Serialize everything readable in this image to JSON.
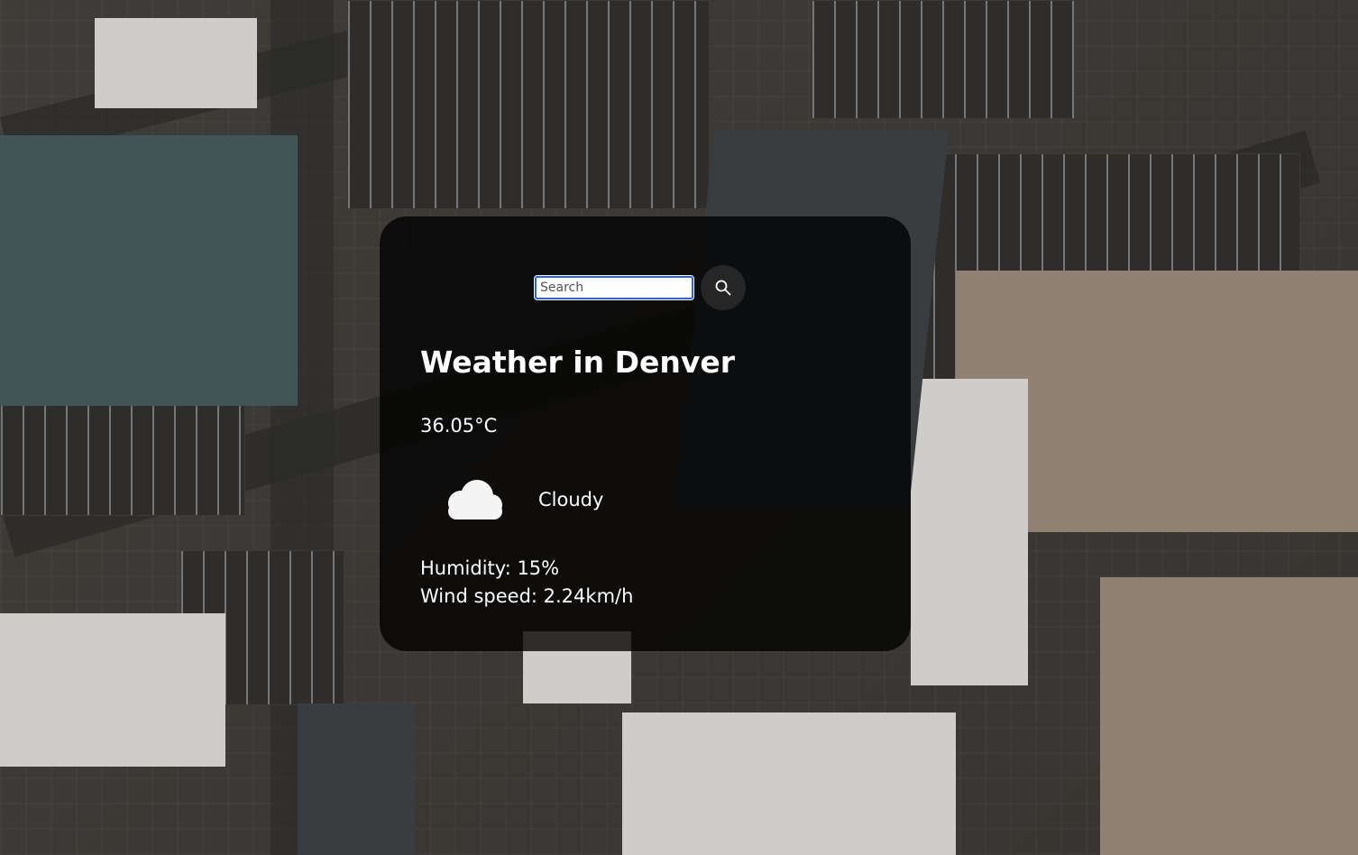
{
  "search": {
    "placeholder": "Search",
    "button_icon": "search-icon"
  },
  "weather": {
    "title": "Weather in Denver",
    "temperature": "36.05°C",
    "condition_icon": "cloud-icon",
    "description": "Cloudy",
    "humidity": "Humidity: 15%",
    "wind_speed": "Wind speed: 2.24km/h"
  },
  "colors": {
    "card_background": "#000000",
    "text": "#ffffff",
    "search_focus_border": "#2d63d8"
  }
}
